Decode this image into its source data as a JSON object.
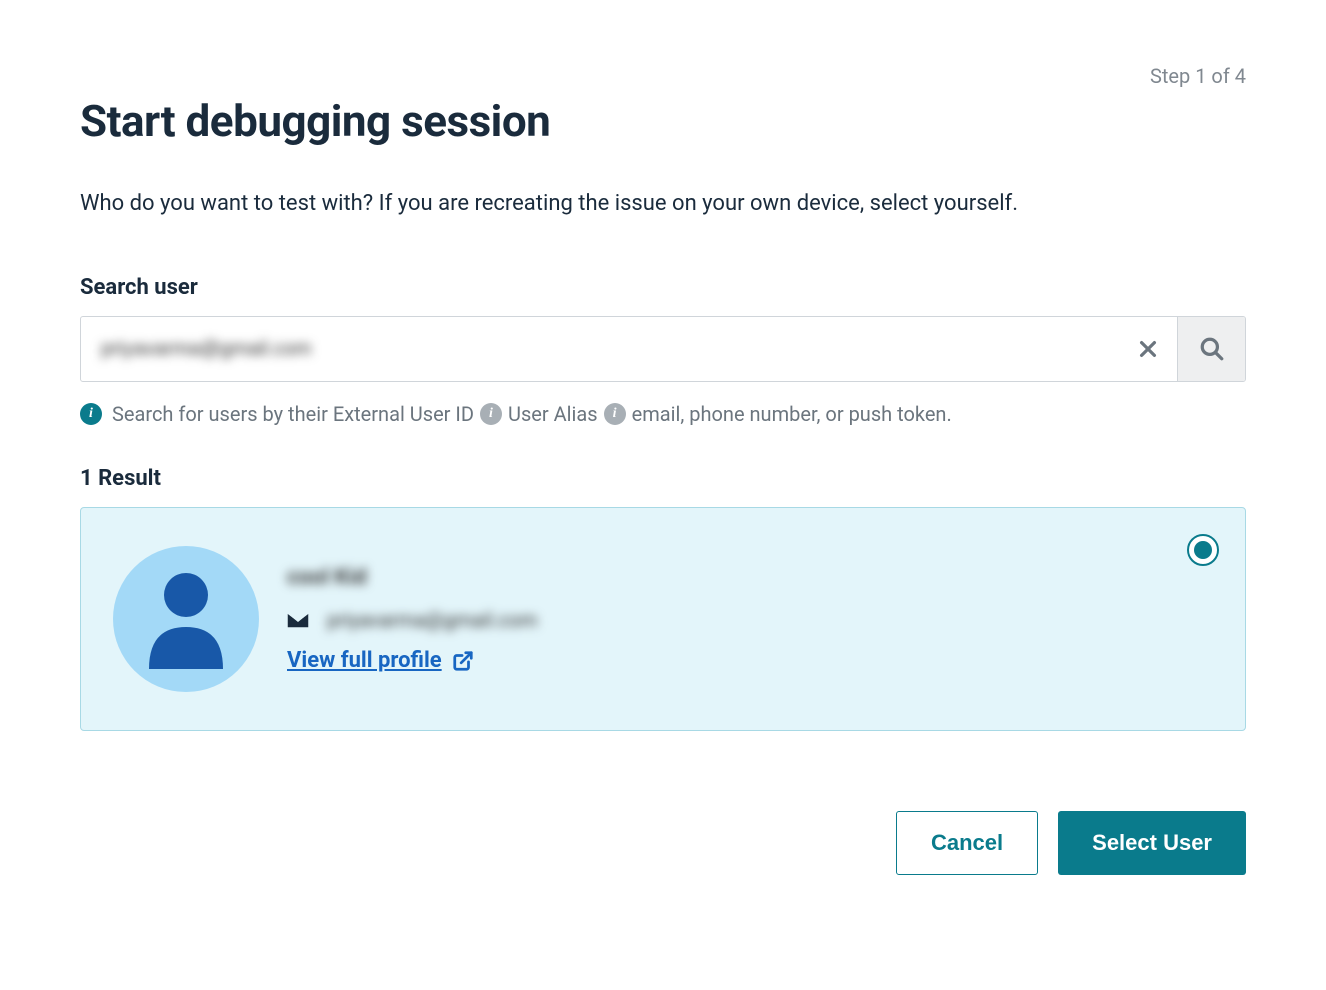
{
  "header": {
    "step_indicator": "Step 1 of 4",
    "title": "Start debugging session",
    "subtitle": "Who do you want to test with? If you are recreating the issue on your own device, select yourself."
  },
  "search": {
    "label": "Search user",
    "value": "priyavarma@gmail.com",
    "help_prefix": "Search for users by their External User ID",
    "help_mid": "User Alias",
    "help_suffix": "email, phone number, or push token."
  },
  "results": {
    "heading": "1 Result",
    "items": [
      {
        "name": "cool Kid",
        "email": "priyavarma@gmail.com",
        "profile_link_label": "View full profile",
        "selected": true
      }
    ]
  },
  "actions": {
    "cancel_label": "Cancel",
    "select_label": "Select User"
  }
}
